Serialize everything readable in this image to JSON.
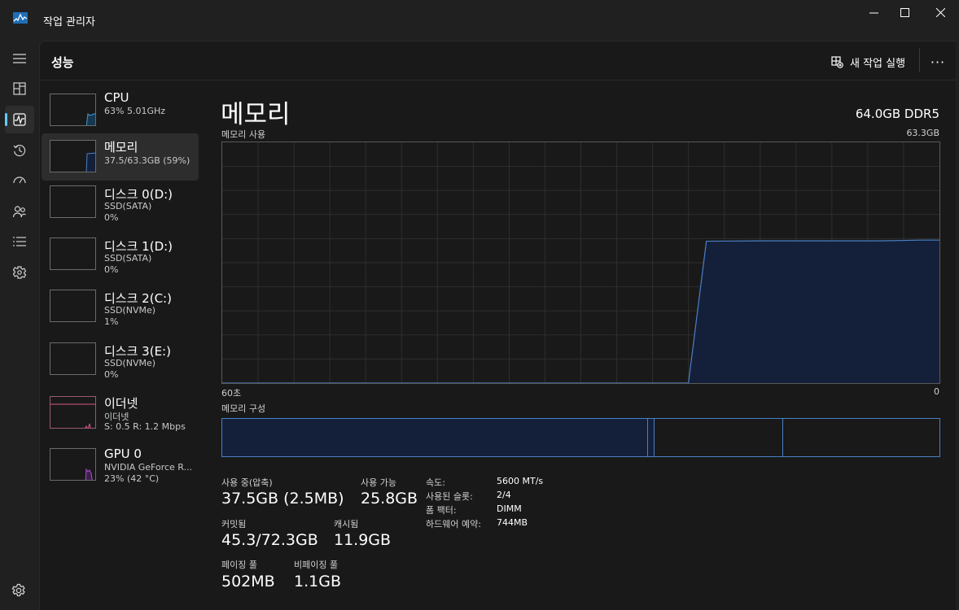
{
  "window": {
    "title": "작업 관리자",
    "controls": {
      "minimize": "—",
      "maximize": "☐",
      "close": "✕"
    }
  },
  "rail": {
    "items": [
      {
        "icon": "hamburger-icon",
        "label": ""
      },
      {
        "icon": "processes-icon",
        "label": ""
      },
      {
        "icon": "performance-icon",
        "label": "",
        "active": true
      },
      {
        "icon": "app-history-icon",
        "label": ""
      },
      {
        "icon": "startup-icon",
        "label": ""
      },
      {
        "icon": "users-icon",
        "label": ""
      },
      {
        "icon": "details-icon",
        "label": ""
      },
      {
        "icon": "services-icon",
        "label": ""
      }
    ],
    "settings_icon": "settings-icon"
  },
  "header": {
    "title": "성능",
    "run_task_label": "새 작업 실행",
    "more_label": "···"
  },
  "resources": [
    {
      "name": "CPU",
      "line1": "63% 5.01GHz",
      "line2": "",
      "graph_color": "#3a9bd8",
      "active": false
    },
    {
      "name": "메모리",
      "line1": "37.5/63.3GB (59%)",
      "line2": "",
      "graph_color": "#4a80c6",
      "active": true
    },
    {
      "name": "디스크 0(D:)",
      "line1": "SSD(SATA)",
      "line2": "0%",
      "graph_color": "#7fb34a",
      "active": false
    },
    {
      "name": "디스크 1(D:)",
      "line1": "SSD(SATA)",
      "line2": "0%",
      "graph_color": "#7fb34a",
      "active": false
    },
    {
      "name": "디스크 2(C:)",
      "line1": "SSD(NVMe)",
      "line2": "1%",
      "graph_color": "#7fb34a",
      "active": false
    },
    {
      "name": "디스크 3(E:)",
      "line1": "SSD(NVMe)",
      "line2": "0%",
      "graph_color": "#7fb34a",
      "active": false
    },
    {
      "name": "이더넷",
      "line1": "이더넷",
      "line2": "S: 0.5  R: 1.2 Mbps",
      "graph_color": "#d9578b",
      "active": false
    },
    {
      "name": "GPU 0",
      "line1": "NVIDIA GeForce R...",
      "line2": "23% (42 °C)",
      "graph_color": "#b04fd6",
      "active": false
    }
  ],
  "detail": {
    "title": "메모리",
    "spec": "64.0GB DDR5",
    "usage_label": "메모리 사용",
    "usage_max": "63.3GB",
    "time_left": "60초",
    "time_right": "0",
    "composition_label": "메모리 구성",
    "accent_color": "#4a80c6"
  },
  "stats": {
    "in_use_label": "사용 중(압축)",
    "in_use_value": "37.5GB (2.5MB)",
    "available_label": "사용 가능",
    "available_value": "25.8GB",
    "committed_label": "커밋됨",
    "committed_value": "45.3/72.3GB",
    "cached_label": "캐시됨",
    "cached_value": "11.9GB",
    "paged_label": "페이징 풀",
    "paged_value": "502MB",
    "nonpaged_label": "비페이징 풀",
    "nonpaged_value": "1.1GB"
  },
  "specs": [
    {
      "key": "속도:",
      "value": "5600 MT/s"
    },
    {
      "key": "사용된 슬롯:",
      "value": "2/4"
    },
    {
      "key": "폼 팩터:",
      "value": "DIMM"
    },
    {
      "key": "하드웨어 예약:",
      "value": "744MB"
    }
  ],
  "chart_data": {
    "type": "area",
    "title": "메모리 사용",
    "xlabel": "",
    "ylabel": "",
    "x_range": [
      "60초",
      "0"
    ],
    "ylim": [
      0,
      63.3
    ],
    "grid": true,
    "series": [
      {
        "x": [
          60,
          21,
          19.5,
          15,
          10,
          5,
          1.5,
          0
        ],
        "values": [
          0,
          0,
          37.3,
          37.4,
          37.4,
          37.4,
          37.6,
          37.6
        ]
      }
    ]
  }
}
